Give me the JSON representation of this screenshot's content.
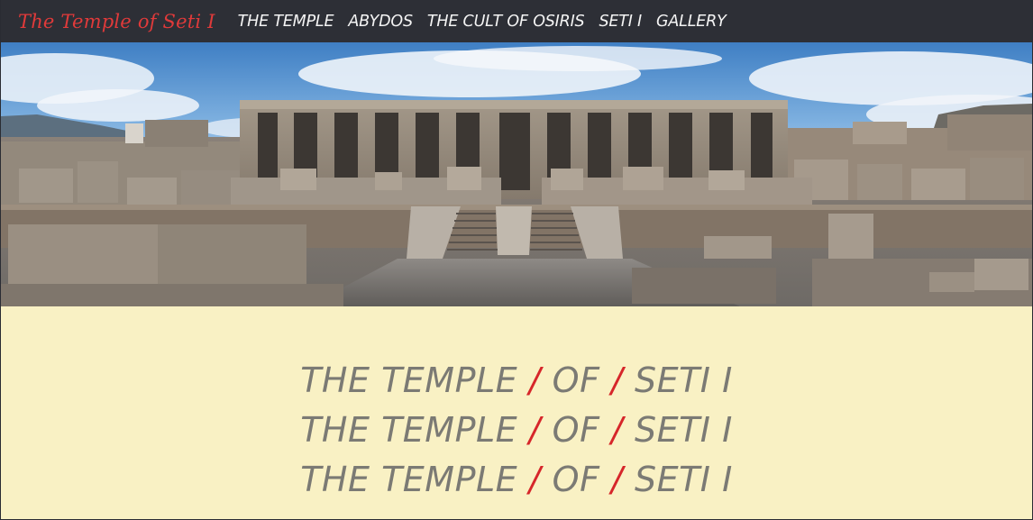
{
  "nav": {
    "brand": "The Temple of Seti I",
    "links": [
      "THE TEMPLE",
      "ABYDOS",
      "THE CULT OF OSIRIS",
      "SETI I",
      "GALLERY"
    ]
  },
  "hero": {
    "image": "temple-of-seti-i-facade-photo"
  },
  "headline": {
    "lines": [
      {
        "part1": "THE TEMPLE",
        "sep1": "/",
        "part2": "OF",
        "sep2": "/",
        "part3": "SETI I"
      },
      {
        "part1": "THE TEMPLE",
        "sep1": "/",
        "part2": "OF",
        "sep2": "/",
        "part3": "SETI I"
      },
      {
        "part1": "THE TEMPLE",
        "sep1": "/",
        "part2": "OF",
        "sep2": "/",
        "part3": "SETI I"
      }
    ]
  },
  "colors": {
    "navbar_bg": "#2d2f36",
    "brand": "#e03a3a",
    "content_bg": "#f9f1c4",
    "heading": "#7b7a74",
    "slash_accent": "#d6262a"
  }
}
